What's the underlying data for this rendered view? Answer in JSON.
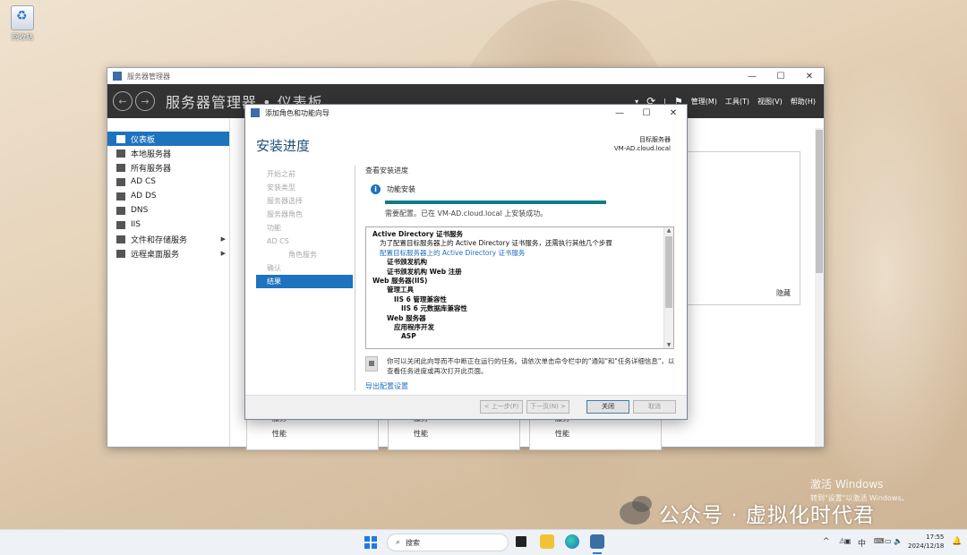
{
  "desktop": {
    "recycle_bin_label": "回收站",
    "activation_title": "激活 Windows",
    "activation_subtitle": "转到\"设置\"以激活 Windows。",
    "watermark_text": "公众号 · 虚拟化时代君"
  },
  "server_manager": {
    "window_title": "服务器管理器",
    "breadcrumb": "服务器管理器 • 仪表板",
    "menus": [
      "管理(M)",
      "工具(T)",
      "视图(V)",
      "帮助(H)"
    ],
    "sidebar": [
      {
        "label": "仪表板",
        "icon": "dashboard-icon",
        "active": true
      },
      {
        "label": "本地服务器",
        "icon": "server-icon"
      },
      {
        "label": "所有服务器",
        "icon": "servers-icon"
      },
      {
        "label": "AD CS",
        "icon": "adcs-icon"
      },
      {
        "label": "AD DS",
        "icon": "adds-icon"
      },
      {
        "label": "DNS",
        "icon": "dns-icon"
      },
      {
        "label": "IIS",
        "icon": "iis-icon"
      },
      {
        "label": "文件和存储服务",
        "icon": "storage-icon",
        "expandable": true
      },
      {
        "label": "远程桌面服务",
        "icon": "remote-desktop-icon",
        "expandable": true
      }
    ],
    "hide_label": "隐藏",
    "tiles": [
      {
        "service": "服务",
        "performance": "性能"
      },
      {
        "service": "服务",
        "performance": "性能"
      },
      {
        "service": "服务",
        "performance": "性能"
      }
    ]
  },
  "wizard": {
    "window_title": "添加角色和功能向导",
    "heading": "安装进度",
    "target_label": "目标服务器",
    "target_server": "VM-AD.cloud.local",
    "steps": [
      {
        "label": "开始之前"
      },
      {
        "label": "安装类型"
      },
      {
        "label": "服务器选择"
      },
      {
        "label": "服务器角色"
      },
      {
        "label": "功能"
      },
      {
        "label": "AD CS"
      },
      {
        "label": "角色服务",
        "sub": true
      },
      {
        "label": "确认"
      },
      {
        "label": "结果",
        "active": true
      }
    ],
    "view_progress_caption": "查看安装进度",
    "feature_install_label": "功能安装",
    "progress": 1.0,
    "status_text": "需要配置。已在 VM-AD.cloud.local 上安装成功。",
    "results": [
      {
        "text": "Active Directory 证书服务",
        "indent": 0,
        "bold": true
      },
      {
        "text": "为了配置目标服务器上的 Active Directory 证书服务，还需执行其他几个步骤",
        "indent": 1
      },
      {
        "text": "配置目标服务器上的 Active Directory 证书服务",
        "indent": 1,
        "link": true
      },
      {
        "text": "证书颁发机构",
        "indent": 2,
        "bold": true
      },
      {
        "text": "证书颁发机构 Web 注册",
        "indent": 2,
        "bold": true
      },
      {
        "text": "Web 服务器(IIS)",
        "indent": 0,
        "bold": true
      },
      {
        "text": "管理工具",
        "indent": 2,
        "bold": true
      },
      {
        "text": "IIS 6 管理兼容性",
        "indent": 3,
        "bold": true
      },
      {
        "text": "IIS 6 元数据库兼容性",
        "indent": 4,
        "bold": true
      },
      {
        "text": "Web 服务器",
        "indent": 2,
        "bold": true
      },
      {
        "text": "应用程序开发",
        "indent": 3,
        "bold": true
      },
      {
        "text": "ASP",
        "indent": 4,
        "bold": true
      }
    ],
    "note_line1": "你可以关闭此向导而不中断正在运行的任务。请依次单击命令栏中的\"通知\"和\"任务详细信息\"，以",
    "note_line2": "查看任务进度或再次打开此页面。",
    "export_link": "导出配置设置",
    "buttons": {
      "previous": "< 上一步(P)",
      "next": "下一页(N) >",
      "close": "关闭",
      "cancel": "取消"
    }
  },
  "taskbar": {
    "search_placeholder": "搜索",
    "ime_label": "中",
    "time": "17:55",
    "date": "2024/12/18"
  }
}
